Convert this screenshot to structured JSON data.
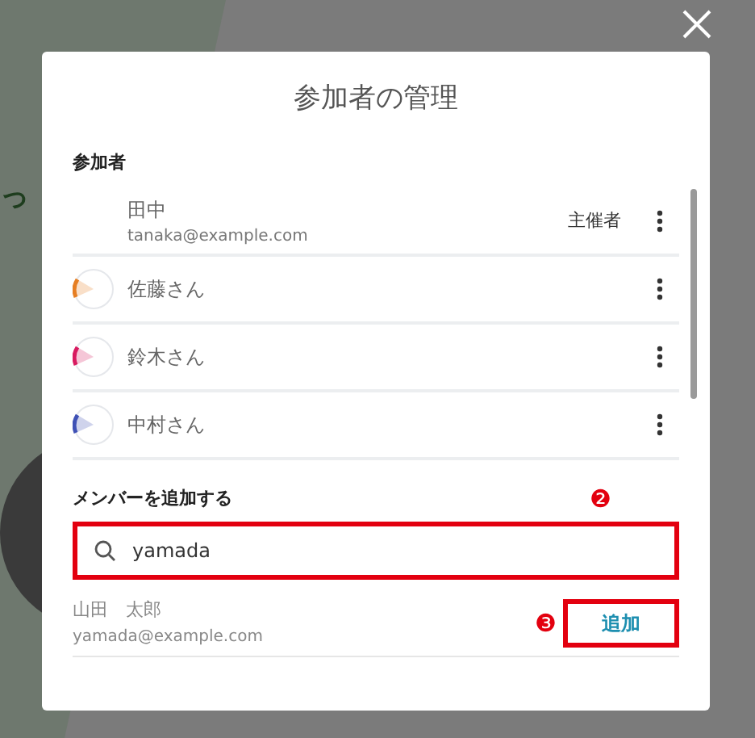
{
  "background_text": "っ",
  "dialog": {
    "title": "参加者の管理",
    "participants_label": "参加者",
    "participants": [
      {
        "name": "田中",
        "email": "tanaka@example.com",
        "role": "主催者",
        "has_avatar": false
      },
      {
        "name": "佐藤さん",
        "has_avatar": true,
        "color": "#e67e22"
      },
      {
        "name": "鈴木さん",
        "has_avatar": true,
        "color": "#d81b60"
      },
      {
        "name": "中村さん",
        "has_avatar": true,
        "color": "#3f51b5"
      }
    ],
    "add_label": "メンバーを追加する",
    "search": {
      "value": "yamada"
    },
    "results": [
      {
        "name": "山田　太郎",
        "email": "yamada@example.com",
        "button": "追加"
      }
    ]
  },
  "callouts": [
    "❷",
    "❸"
  ]
}
